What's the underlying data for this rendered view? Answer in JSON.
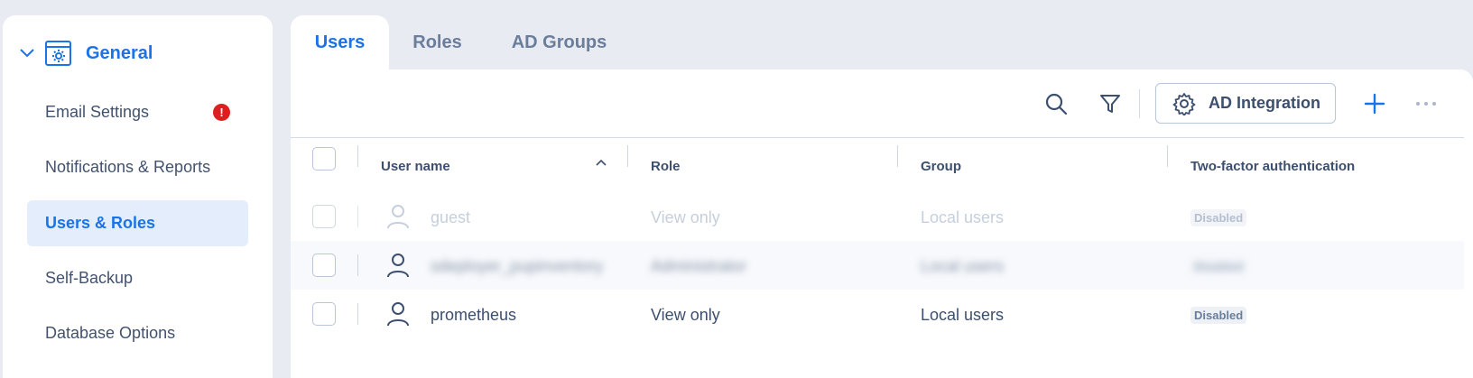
{
  "sidebar": {
    "section_title": "General",
    "items": [
      {
        "label": "Email Settings",
        "badge": "!"
      },
      {
        "label": "Notifications & Reports"
      },
      {
        "label": "Users & Roles",
        "active": true
      },
      {
        "label": "Self-Backup"
      },
      {
        "label": "Database Options"
      }
    ]
  },
  "tabs": [
    {
      "label": "Users",
      "active": true
    },
    {
      "label": "Roles"
    },
    {
      "label": "AD Groups"
    }
  ],
  "toolbar": {
    "search_icon": "search-icon",
    "filter_icon": "filter-icon",
    "ad_button_label": "AD Integration",
    "add_icon": "plus-icon",
    "more_icon": "more-icon"
  },
  "table": {
    "columns": [
      "User name",
      "Role",
      "Group",
      "Two-factor authentication"
    ],
    "sort": {
      "column": "User name",
      "direction": "ascending"
    },
    "rows": [
      {
        "username": "guest",
        "role": "View only",
        "group": "Local users",
        "two_factor": "Disabled",
        "state": "disabled"
      },
      {
        "username": "sdeployer_pupinventory",
        "role": "Administrator",
        "group": "Local users",
        "two_factor": "Disabled",
        "state": "blurred"
      },
      {
        "username": "prometheus",
        "role": "View only",
        "group": "Local users",
        "two_factor": "Disabled",
        "state": "normal"
      }
    ]
  },
  "colors": {
    "accent": "#1a73e8",
    "badge_red": "#e01e1e",
    "background": "#e8ebf2"
  }
}
